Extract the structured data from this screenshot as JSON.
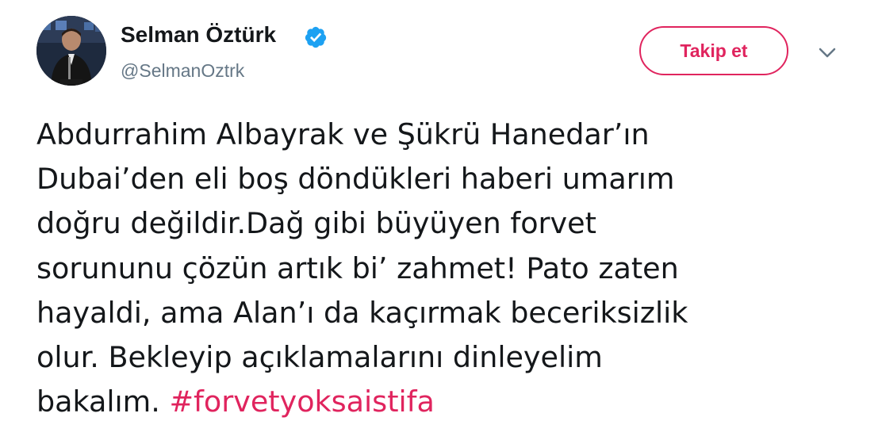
{
  "tweet": {
    "author": {
      "display_name": "Selman Öztürk",
      "handle": "@SelmanOztrk",
      "verified": true,
      "verified_icon": "verified-badge-icon"
    },
    "follow_label": "Takip et",
    "menu_icon": "chevron-down-icon",
    "text_lines": [
      "Abdurrahim Albayrak ve Şükrü Hanedar’ın",
      "Dubai’den eli boş döndükleri haberi umarım",
      "doğru değildir.Dağ gibi büyüyen forvet",
      "sorununu çözün artık bi’ zahmet! Pato zaten",
      "hayaldi, ama Alan’ı da kaçırmak beceriksizlik",
      "olur. Bekleyip açıklamalarını dinleyelim",
      "bakalım."
    ],
    "hashtag": "#forvetyoksaistifa"
  },
  "colors": {
    "accent": "#e0245e",
    "verified": "#1da1f2",
    "text": "#14171a",
    "muted": "#657786"
  }
}
